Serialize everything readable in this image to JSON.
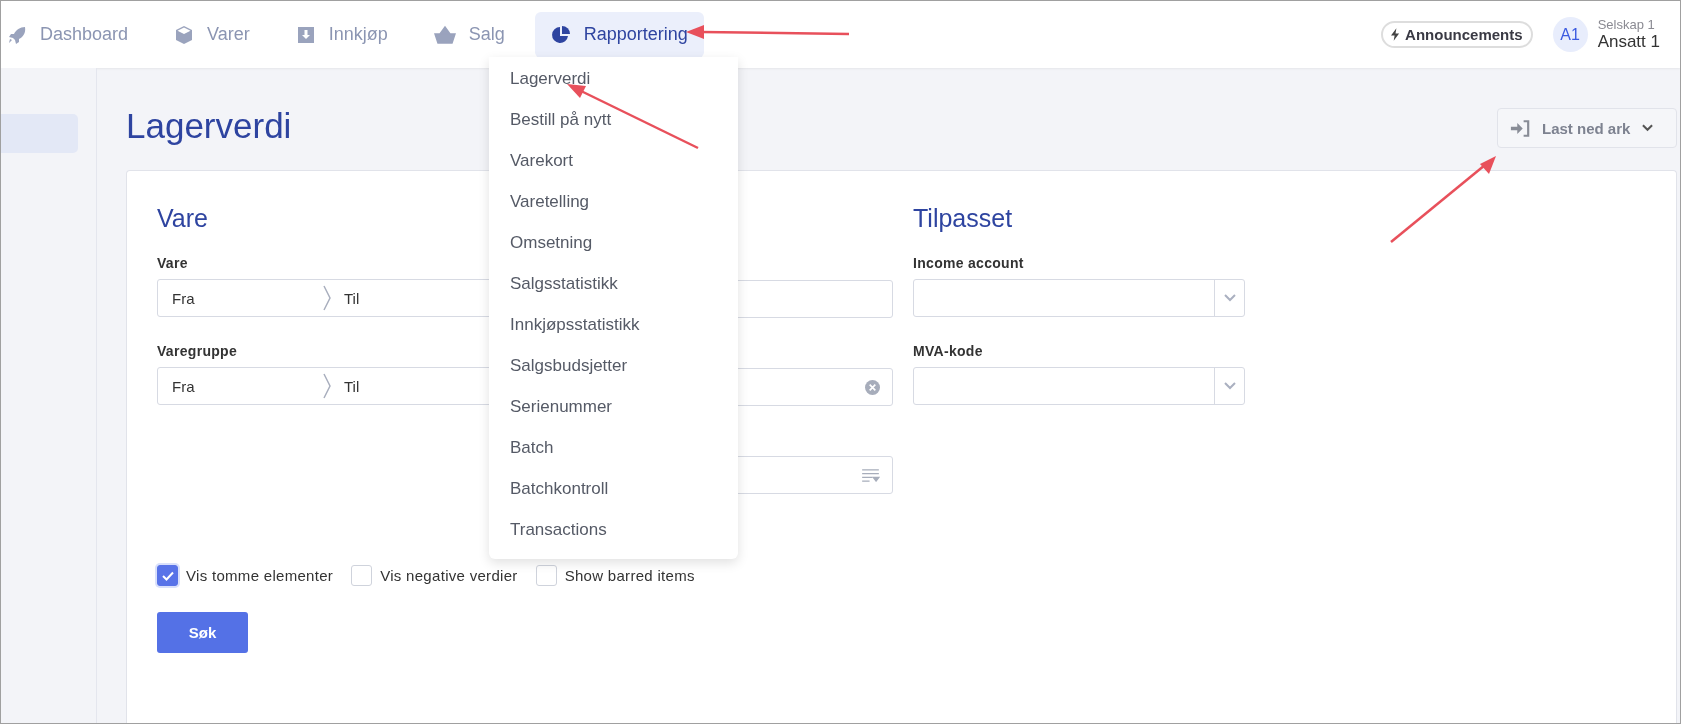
{
  "nav": {
    "items": [
      {
        "label": "Dashboard",
        "selected": false
      },
      {
        "label": "Varer",
        "selected": false
      },
      {
        "label": "Innkjøp",
        "selected": false
      },
      {
        "label": "Salg",
        "selected": false
      },
      {
        "label": "Rapportering",
        "selected": true
      }
    ]
  },
  "announcements": "Announcements",
  "user": {
    "initials": "A1",
    "company": "Selskap 1",
    "name": "Ansatt 1"
  },
  "page": {
    "title": "Lagerverdi",
    "download_button": "Last ned ark"
  },
  "columns": [
    {
      "heading": "Vare",
      "fields": [
        {
          "kind": "range",
          "label": "Vare",
          "from": "Fra",
          "to": "Til"
        },
        {
          "kind": "range",
          "label": "Varegruppe",
          "from": "Fra",
          "to": "Til"
        }
      ]
    },
    {
      "fields": [
        {
          "kind": "text"
        },
        {
          "kind": "clear"
        },
        {
          "kind": "list"
        }
      ]
    },
    {
      "heading": "Tilpasset",
      "fields": [
        {
          "kind": "select",
          "label": "Income account"
        },
        {
          "kind": "select",
          "label": "MVA-kode"
        }
      ]
    }
  ],
  "checkboxes": [
    {
      "label": "Vis tomme elementer",
      "checked": true
    },
    {
      "label": "Vis negative verdier",
      "checked": false
    },
    {
      "label": "Show barred items",
      "checked": false
    }
  ],
  "search_button": "Søk",
  "menu": {
    "items": [
      "Lagerverdi",
      "Bestill på nytt",
      "Varekort",
      "Varetelling",
      "Omsetning",
      "Salgsstatistikk",
      "Innkjøpsstatistikk",
      "Salgsbudsjetter",
      "Serienummer",
      "Batch",
      "Batchkontroll",
      "Transactions"
    ]
  }
}
